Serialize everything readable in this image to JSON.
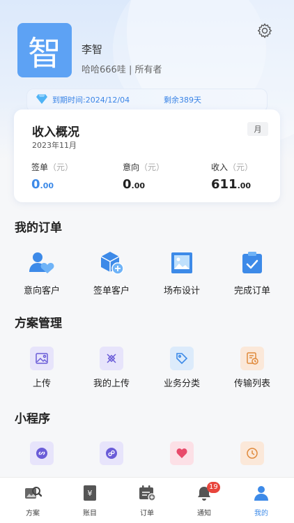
{
  "profile": {
    "avatar_char": "智",
    "name": "李智",
    "subtitle": "哈哈666哇 | 所有者"
  },
  "vip": {
    "expiry": "到期时间:2024/12/04",
    "remaining": "剩余389天"
  },
  "income": {
    "title": "收入概况",
    "period": "2023年11月",
    "range_button": "月",
    "stats": [
      {
        "label": "签单",
        "unit": "（元）",
        "int": "0",
        "dec": ".00"
      },
      {
        "label": "意向",
        "unit": "（元）",
        "int": "0",
        "dec": ".00"
      },
      {
        "label": "收入",
        "unit": "（元）",
        "int": "611",
        "dec": ".00"
      }
    ]
  },
  "orders": {
    "title": "我的订单",
    "items": [
      {
        "label": "意向客户",
        "icon": "intent-customer-icon"
      },
      {
        "label": "签单客户",
        "icon": "signed-customer-icon"
      },
      {
        "label": "场布设计",
        "icon": "venue-design-icon"
      },
      {
        "label": "完成订单",
        "icon": "completed-order-icon"
      }
    ]
  },
  "plans": {
    "title": "方案管理",
    "items": [
      {
        "label": "上传",
        "icon": "upload-image-icon"
      },
      {
        "label": "我的上传",
        "icon": "my-uploads-icon"
      },
      {
        "label": "业务分类",
        "icon": "tag-icon"
      },
      {
        "label": "传输列表",
        "icon": "transfer-list-icon"
      }
    ]
  },
  "mini": {
    "title": "小程序",
    "items": [
      {
        "label": "",
        "icon": "link-icon"
      },
      {
        "label": "",
        "icon": "mini-program-icon"
      },
      {
        "label": "",
        "icon": "heart-icon"
      },
      {
        "label": "",
        "icon": "clock-icon"
      }
    ]
  },
  "tabs": [
    {
      "label": "方案",
      "icon": "plan-tab-icon"
    },
    {
      "label": "账目",
      "icon": "ledger-tab-icon"
    },
    {
      "label": "订单",
      "icon": "order-tab-icon"
    },
    {
      "label": "通知",
      "icon": "bell-icon",
      "badge": "19"
    },
    {
      "label": "我的",
      "icon": "profile-tab-icon"
    }
  ],
  "colors": {
    "accent": "#3d8ae8",
    "avatar_bg": "#5da2f4",
    "badge": "#e8453c"
  }
}
